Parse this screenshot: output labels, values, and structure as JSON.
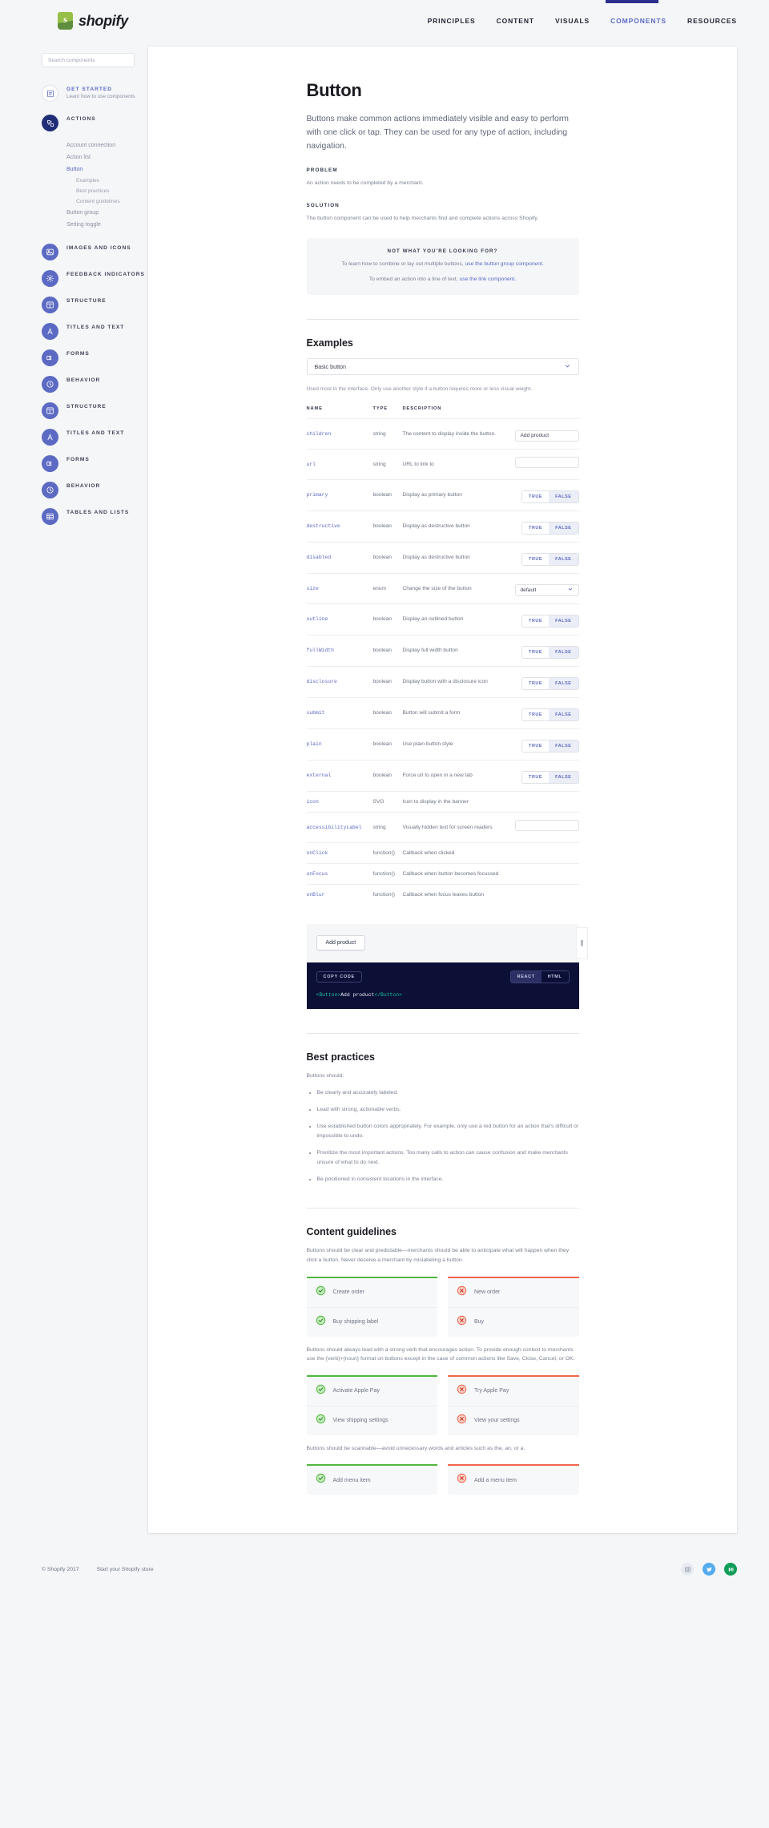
{
  "header": {
    "brand": "shopify",
    "nav": [
      {
        "label": "PRINCIPLES",
        "active": false
      },
      {
        "label": "CONTENT",
        "active": false
      },
      {
        "label": "VISUALS",
        "active": false
      },
      {
        "label": "COMPONENTS",
        "active": true
      },
      {
        "label": "RESOURCES",
        "active": false
      }
    ]
  },
  "sidebar": {
    "search_placeholder": "Search components",
    "get_started": {
      "title": "GET STARTED",
      "subtitle": "Learn how to use components",
      "icon": "document-icon"
    },
    "actions_group": {
      "title": "ACTIONS",
      "icon": "actions-icon"
    },
    "actions_links": [
      {
        "label": "Account connection",
        "active": false
      },
      {
        "label": "Action list",
        "active": false
      },
      {
        "label": "Button",
        "active": true
      }
    ],
    "button_subitems": [
      {
        "label": "Examples"
      },
      {
        "label": "Best practices"
      },
      {
        "label": "Content guidelines"
      }
    ],
    "actions_links_tail": [
      {
        "label": "Button group",
        "active": false
      },
      {
        "label": "Setting toggle",
        "active": false
      }
    ],
    "groups": [
      {
        "title": "IMAGES AND ICONS",
        "icon": "image-icon"
      },
      {
        "title": "FEEDBACK INDICATORS",
        "icon": "spinner-icon"
      },
      {
        "title": "STRUCTURE",
        "icon": "layout-icon"
      },
      {
        "title": "TITLES AND TEXT",
        "icon": "typography-icon"
      },
      {
        "title": "FORMS",
        "icon": "form-icon"
      },
      {
        "title": "BEHAVIOR",
        "icon": "behavior-icon"
      },
      {
        "title": "STRUCTURE",
        "icon": "layout-icon"
      },
      {
        "title": "TITLES AND TEXT",
        "icon": "typography-icon"
      },
      {
        "title": "FORMS",
        "icon": "form-icon"
      },
      {
        "title": "BEHAVIOR",
        "icon": "behavior-icon"
      },
      {
        "title": "TABLES AND LISTS",
        "icon": "table-icon"
      }
    ]
  },
  "main": {
    "title": "Button",
    "lede": "Buttons make common actions immediately visible and easy to perform with one click or tap. They can be used for any type of action, including navigation.",
    "problem_label": "PROBLEM",
    "problem_text": "An action needs to be completed by a merchant.",
    "solution_label": "SOLUTION",
    "solution_text": "The button component can be used to help merchants find and complete actions across Shopify.",
    "callout": {
      "title": "NOT WHAT YOU'RE LOOKING FOR?",
      "line1_pre": "To learn how to combine or lay out multiple buttons, ",
      "line1_link": "use the button group component.",
      "line2_pre": "To embed an action into a line of text, ",
      "line2_link": "use the link component."
    },
    "examples": {
      "heading": "Examples",
      "selected": "Basic button",
      "helper": "Used most in the interface. Only use another style if a button requires more or less visual weight.",
      "columns": [
        "NAME",
        "TYPE",
        "DESCRIPTION"
      ],
      "rows": [
        {
          "name": "children",
          "type": "string",
          "desc": "The content to display inside the button.",
          "control": "text",
          "value": "Add product"
        },
        {
          "name": "url",
          "type": "string",
          "desc": "URL to link to",
          "control": "text",
          "value": ""
        },
        {
          "name": "primary",
          "type": "boolean",
          "desc": "Display as primary button",
          "control": "toggle",
          "on": "FALSE",
          "true_label": "TRUE",
          "false_label": "FALSE"
        },
        {
          "name": "destructive",
          "type": "boolean",
          "desc": "Display as destructive button",
          "control": "toggle",
          "on": "FALSE",
          "true_label": "TRUE",
          "false_label": "FALSE"
        },
        {
          "name": "disabled",
          "type": "boolean",
          "desc": "Display as destructive button",
          "control": "toggle",
          "on": "FALSE",
          "true_label": "TRUE",
          "false_label": "FALSE"
        },
        {
          "name": "size",
          "type": "enum",
          "desc": "Change the size of the button",
          "control": "select",
          "value": "default"
        },
        {
          "name": "outline",
          "type": "boolean",
          "desc": "Display an outlined button",
          "control": "toggle",
          "on": "FALSE",
          "true_label": "TRUE",
          "false_label": "FALSE"
        },
        {
          "name": "fullWidth",
          "type": "boolean",
          "desc": "Display full width button",
          "control": "toggle",
          "on": "FALSE",
          "true_label": "TRUE",
          "false_label": "FALSE"
        },
        {
          "name": "disclosure",
          "type": "boolean",
          "desc": "Display button with a disclosure icon",
          "control": "toggle",
          "on": "FALSE",
          "true_label": "TRUE",
          "false_label": "FALSE"
        },
        {
          "name": "submit",
          "type": "boolean",
          "desc": "Button will submit a form",
          "control": "toggle",
          "on": "FALSE",
          "true_label": "TRUE",
          "false_label": "FALSE"
        },
        {
          "name": "plain",
          "type": "boolean",
          "desc": "Use plain button style",
          "control": "toggle",
          "on": "FALSE",
          "true_label": "TRUE",
          "false_label": "FALSE"
        },
        {
          "name": "external",
          "type": "boolean",
          "desc": "Force url to open in a new tab",
          "control": "toggle",
          "on": "FALSE",
          "true_label": "TRUE",
          "false_label": "FALSE"
        },
        {
          "name": "icon",
          "type": "SVG",
          "desc": "Icon to display in the banner",
          "control": "none",
          "value": ""
        },
        {
          "name": "accessibilityLabel",
          "type": "string",
          "desc": "Visually hidden text for screen readers",
          "control": "text",
          "value": ""
        },
        {
          "name": "onClick",
          "type": "function()",
          "desc": "Callback when clicked",
          "control": "none",
          "value": ""
        },
        {
          "name": "onFocus",
          "type": "function()",
          "desc": "Callback when button becomes focussed",
          "control": "none",
          "value": ""
        },
        {
          "name": "onBlur",
          "type": "function()",
          "desc": "Callback when focus leaves button",
          "control": "none",
          "value": ""
        }
      ]
    },
    "preview": {
      "button_label": "Add product",
      "resize_handle": "||"
    },
    "code": {
      "copy_label": "COPY CODE",
      "langs": [
        {
          "label": "REACT",
          "active": true
        },
        {
          "label": "HTML",
          "active": false
        }
      ],
      "open_tag": "<Button>",
      "content": "Add product",
      "close_tag": "</Button>"
    },
    "best_practices": {
      "heading": "Best practices",
      "intro": "Buttons should:",
      "items": [
        "Be clearly and accurately labeled.",
        "Lead with strong, actionable verbs.",
        "Use established button colors appropriately. For example, only use a red button for an action that's difficult or impossible to undo.",
        "Prioritize the most important actions. Too many calls to action can cause confusion and make merchants unsure of what to do next.",
        "Be positioned in consistent locations in the interface."
      ]
    },
    "content_guidelines": {
      "heading": "Content guidelines",
      "intro1": "Buttons should be clear and predictable—merchants should be able to anticipate what will happen when they click a button. Never deceive a merchant by mislabeling a button.",
      "pair1": {
        "good": [
          "Create order",
          "Buy shipping label"
        ],
        "bad": [
          "New order",
          "Buy"
        ]
      },
      "intro2": "Buttons should always lead with a strong verb that encourages action. To provide enough context to merchants use the {verb}+{noun} format on buttons except in the case of common actions like Save, Close, Cancel, or OK.",
      "pair2": {
        "good": [
          "Activate Apple Pay",
          "View shipping settings"
        ],
        "bad": [
          "Try Apple Pay",
          "View your settings"
        ]
      },
      "intro3": "Buttons should be scannable—avoid unnecessary words and articles such as the, an, or a.",
      "pair3": {
        "good": [
          "Add menu item"
        ],
        "bad": [
          "Add a menu item"
        ]
      }
    }
  },
  "footer": {
    "copyright": "© Shopify 2017",
    "store_link": "Start your Shopify store",
    "socials": [
      "instagram-icon",
      "twitter-icon",
      "medium-icon"
    ]
  },
  "colors": {
    "accent": "#5c6ac4",
    "code_bg": "#0c0f36",
    "good": "#50b83c",
    "bad": "#f4654b",
    "page_bg": "#f4f6f8"
  }
}
